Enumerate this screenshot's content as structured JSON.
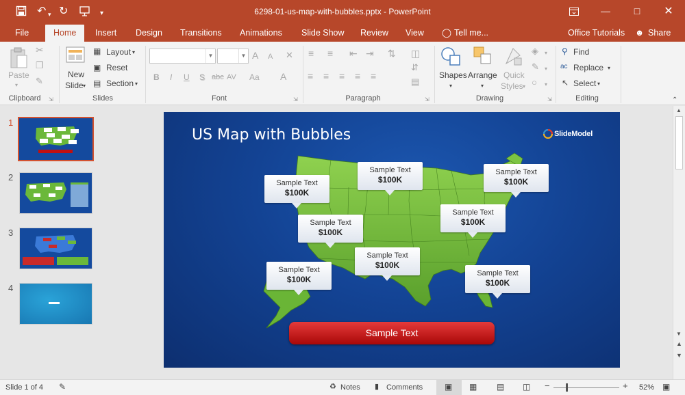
{
  "titlebar": {
    "title": "6298-01-us-map-with-bubbles.pptx - PowerPoint"
  },
  "tabs": [
    "File",
    "Home",
    "Insert",
    "Design",
    "Transitions",
    "Animations",
    "Slide Show",
    "Review",
    "View",
    "Tell me...",
    "Office Tutorials",
    "Share"
  ],
  "ribbon": {
    "clipboard": {
      "paste": "Paste",
      "label": "Clipboard"
    },
    "slides": {
      "new_slide_1": "New",
      "new_slide_2": "Slide",
      "layout": "Layout",
      "reset": "Reset",
      "section": "Section",
      "label": "Slides"
    },
    "font": {
      "bold": "B",
      "italic": "I",
      "underline": "U",
      "shadow": "S",
      "strike": "abc",
      "spacing": "AV",
      "case": "Aa",
      "color": "A",
      "grow": "A",
      "shrink": "A",
      "label": "Font"
    },
    "paragraph": {
      "label": "Paragraph"
    },
    "drawing": {
      "shapes": "Shapes",
      "arrange": "Arrange",
      "quick_1": "Quick",
      "quick_2": "Styles",
      "label": "Drawing"
    },
    "editing": {
      "find": "Find",
      "replace": "Replace",
      "select": "Select",
      "label": "Editing"
    }
  },
  "thumbnails": [
    {
      "num": "1",
      "selected": true
    },
    {
      "num": "2",
      "selected": false
    },
    {
      "num": "3",
      "selected": false
    },
    {
      "num": "4",
      "selected": false
    }
  ],
  "slide": {
    "title": "US Map with Bubbles",
    "brand": "SlideModel",
    "bubbles": [
      {
        "text": "Sample Text",
        "value": "$100K"
      },
      {
        "text": "Sample Text",
        "value": "$100K"
      },
      {
        "text": "Sample Text",
        "value": "$100K"
      },
      {
        "text": "Sample Text",
        "value": "$100K"
      },
      {
        "text": "Sample Text",
        "value": "$100K"
      },
      {
        "text": "Sample Text",
        "value": "$100K"
      },
      {
        "text": "Sample Text",
        "value": "$100K"
      },
      {
        "text": "Sample Text",
        "value": "$100K"
      }
    ],
    "bottom_label": "Sample Text"
  },
  "status": {
    "slide": "Slide 1 of 4",
    "notes": "Notes",
    "comments": "Comments",
    "zoom": "52%"
  }
}
